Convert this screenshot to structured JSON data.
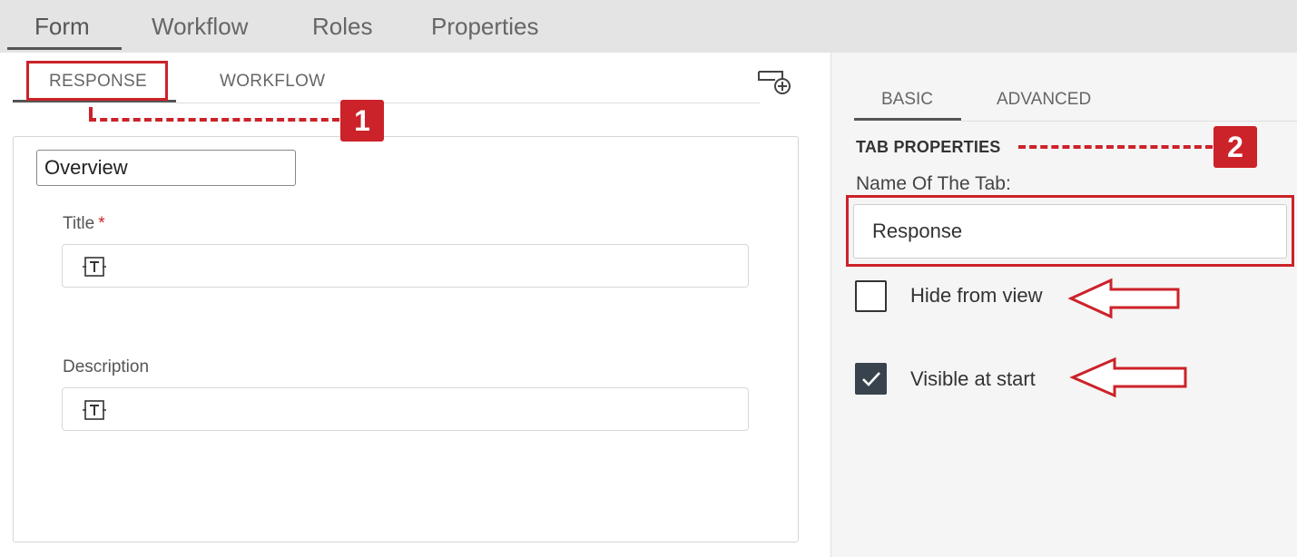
{
  "top_tabs": [
    {
      "label": "Form"
    },
    {
      "label": "Workflow"
    },
    {
      "label": "Roles"
    },
    {
      "label": "Properties"
    }
  ],
  "form_tabs": [
    {
      "label": "RESPONSE"
    },
    {
      "label": "WORKFLOW"
    }
  ],
  "form": {
    "tab_name_value": "Overview",
    "title_label": "Title",
    "title_required_mark": "*",
    "description_label": "Description"
  },
  "properties_tabs": [
    {
      "label": "BASIC"
    },
    {
      "label": "ADVANCED"
    }
  ],
  "tab_properties": {
    "section_title": "TAB PROPERTIES",
    "name_label": "Name Of The Tab:",
    "name_value": "Response",
    "hide_from_view": {
      "label": "Hide from view",
      "checked": false
    },
    "visible_at_start": {
      "label": "Visible at start",
      "checked": true
    }
  },
  "annotations": {
    "callout_1": "1",
    "callout_2": "2",
    "accent_color": "#cc2229"
  },
  "icons": {
    "add_tab": "add-tab-icon",
    "text_field": "text-field-icon",
    "checkmark": "checkmark-icon",
    "arrow": "left-arrow-icon"
  }
}
